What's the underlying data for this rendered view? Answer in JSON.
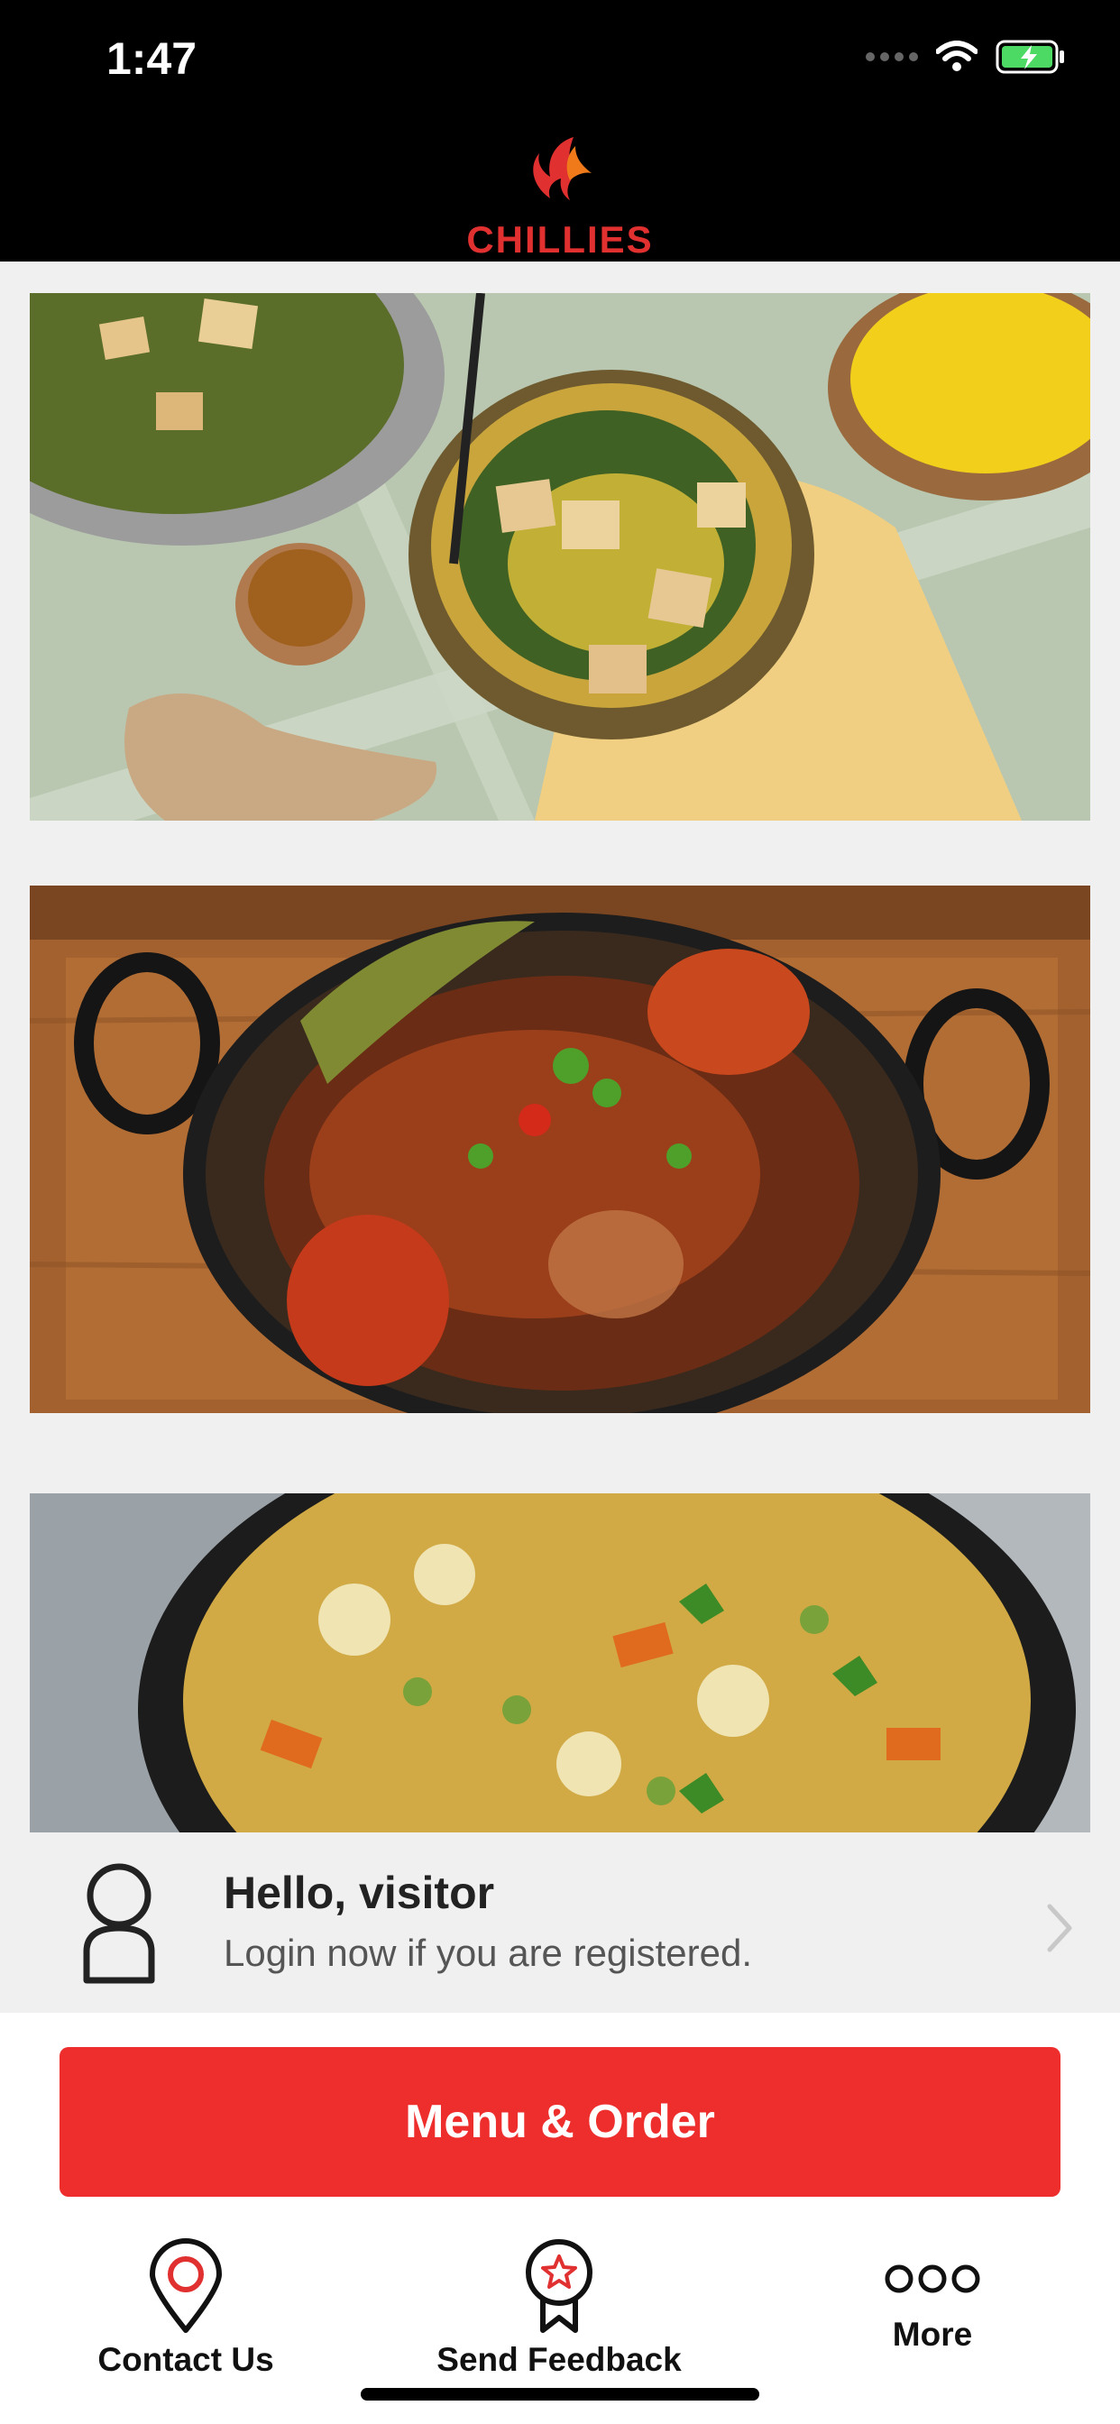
{
  "status_bar": {
    "time": "1:47"
  },
  "header": {
    "logo_text": "CHILLIES"
  },
  "visitor": {
    "title": "Hello, visitor",
    "subtitle": "Login now if you are registered.",
    "avatar_icon": "person-outline-icon",
    "chevron_icon": "chevron-right-icon"
  },
  "order_button": {
    "label": "Menu & Order"
  },
  "tabs": [
    {
      "label": "Contact Us",
      "icon": "location-pin-icon"
    },
    {
      "label": "Send Feedback",
      "icon": "award-ribbon-icon"
    },
    {
      "label": "More",
      "icon": "more-dots-icon"
    }
  ],
  "colors": {
    "accent": "#ee2d2d",
    "header_bg": "#000000",
    "page_bg": "#f0f0f0"
  }
}
